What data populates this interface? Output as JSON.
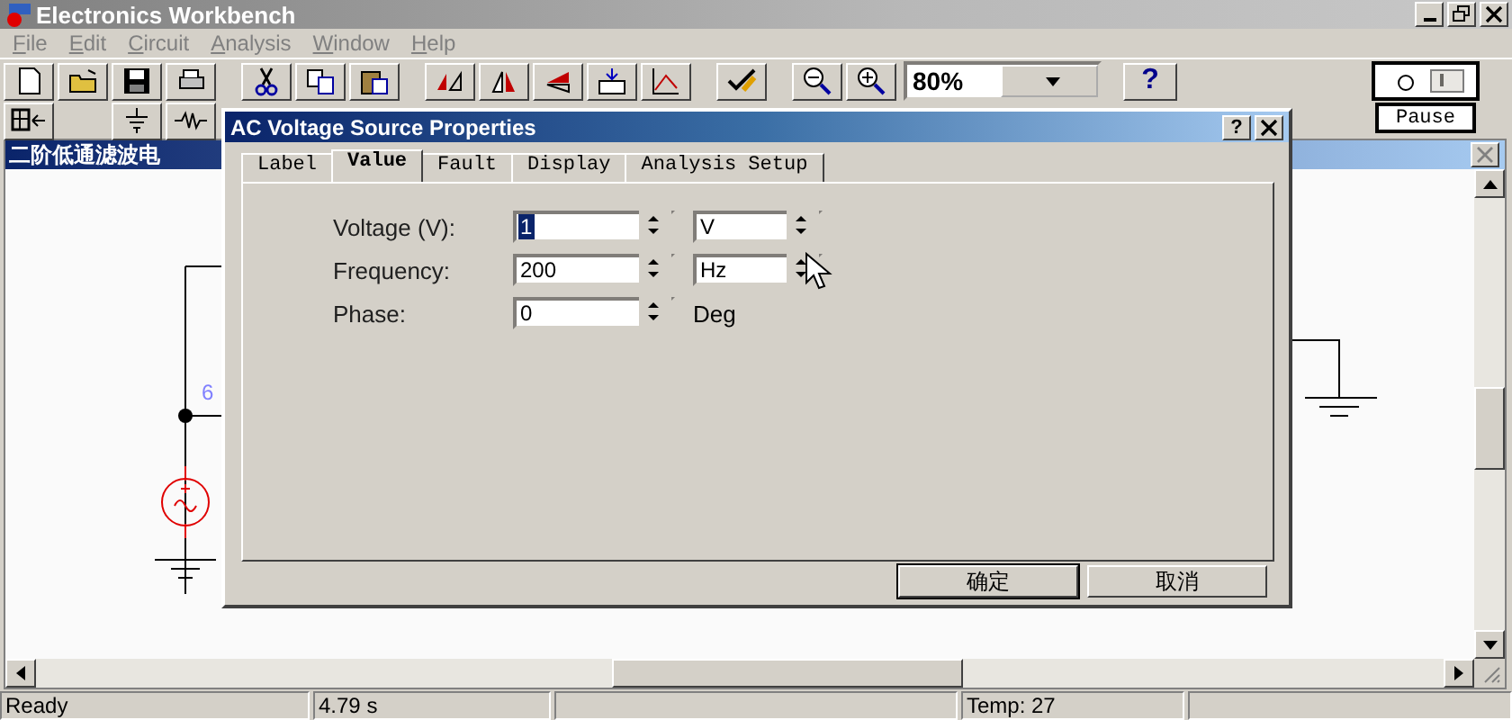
{
  "window": {
    "title": "Electronics Workbench"
  },
  "menu": [
    {
      "label": "File"
    },
    {
      "label": "Edit"
    },
    {
      "label": "Circuit"
    },
    {
      "label": "Analysis"
    },
    {
      "label": "Window"
    },
    {
      "label": "Help"
    }
  ],
  "toolbar": {
    "zoom": "80%",
    "help": "?",
    "pause": "Pause",
    "power_on": false
  },
  "child_window": {
    "title": "二阶低通滤波电",
    "node_label": "6"
  },
  "dialog": {
    "title": "AC Voltage Source Properties",
    "help": "?",
    "tabs": [
      {
        "label": "Label",
        "selected": false
      },
      {
        "label": "Value",
        "selected": true
      },
      {
        "label": "Fault",
        "selected": false
      },
      {
        "label": "Display",
        "selected": false
      },
      {
        "label": "Analysis Setup",
        "selected": false
      }
    ],
    "fields": [
      {
        "label": "Voltage (V):",
        "value": "1",
        "highlighted": true,
        "unit": "V",
        "kind": "spin"
      },
      {
        "label": "Frequency:",
        "value": "200",
        "highlighted": false,
        "unit": "Hz",
        "kind": "spin"
      },
      {
        "label": "Phase:",
        "value": "0",
        "highlighted": false,
        "unit": "Deg",
        "kind": "text"
      }
    ],
    "buttons": [
      {
        "label": "确定",
        "default": true
      },
      {
        "label": "取消",
        "default": false
      }
    ]
  },
  "status_bar": [
    {
      "kind": "text",
      "text": "Ready"
    },
    {
      "kind": "text",
      "text": "4.79 s"
    },
    {
      "kind": "blank"
    },
    {
      "kind": "text",
      "text": "Temp: 27"
    },
    {
      "kind": "blank"
    }
  ]
}
